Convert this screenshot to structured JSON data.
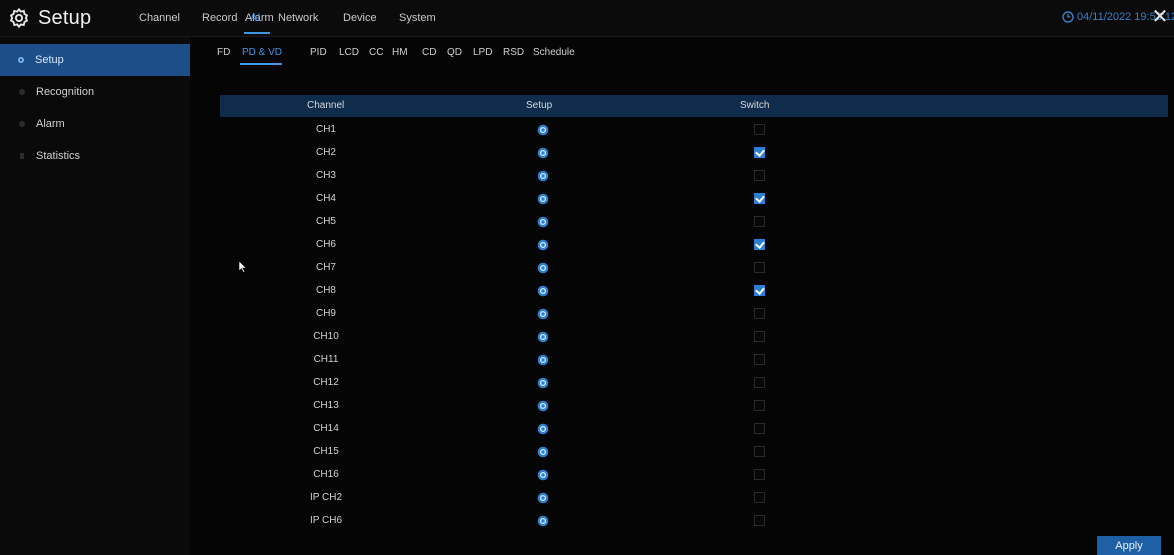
{
  "app": {
    "title": "Setup",
    "datetime": "04/11/2022 19:53:12"
  },
  "main_nav": [
    {
      "label": "Channel"
    },
    {
      "label": "Record"
    },
    {
      "label": "Alarm"
    },
    {
      "label": "AI",
      "active": true
    },
    {
      "label": "Network"
    },
    {
      "label": "Device"
    },
    {
      "label": "System"
    }
  ],
  "sidebar": {
    "items": [
      {
        "label": "Setup",
        "active": true
      },
      {
        "label": "Recognition"
      },
      {
        "label": "Alarm"
      },
      {
        "label": "Statistics"
      }
    ]
  },
  "sub_tabs": [
    {
      "label": "FD"
    },
    {
      "label": "PD & VD",
      "active": true
    },
    {
      "label": "PID"
    },
    {
      "label": "LCD"
    },
    {
      "label": "CC"
    },
    {
      "label": "HM"
    },
    {
      "label": "CD"
    },
    {
      "label": "QD"
    },
    {
      "label": "LPD"
    },
    {
      "label": "RSD"
    },
    {
      "label": "Schedule"
    }
  ],
  "table": {
    "headers": {
      "channel": "Channel",
      "setup": "Setup",
      "switch": "Switch"
    },
    "rows": [
      {
        "channel": "CH1",
        "switch": false
      },
      {
        "channel": "CH2",
        "switch": true
      },
      {
        "channel": "CH3",
        "switch": false
      },
      {
        "channel": "CH4",
        "switch": true
      },
      {
        "channel": "CH5",
        "switch": false
      },
      {
        "channel": "CH6",
        "switch": true
      },
      {
        "channel": "CH7",
        "switch": false
      },
      {
        "channel": "CH8",
        "switch": true
      },
      {
        "channel": "CH9",
        "switch": false
      },
      {
        "channel": "CH10",
        "switch": false
      },
      {
        "channel": "CH11",
        "switch": false
      },
      {
        "channel": "CH12",
        "switch": false
      },
      {
        "channel": "CH13",
        "switch": false
      },
      {
        "channel": "CH14",
        "switch": false
      },
      {
        "channel": "CH15",
        "switch": false
      },
      {
        "channel": "CH16",
        "switch": false
      },
      {
        "channel": "IP CH2",
        "switch": false
      },
      {
        "channel": "IP CH6",
        "switch": false
      }
    ]
  },
  "footer": {
    "apply_label": "Apply"
  },
  "colors": {
    "accent": "#3d95e6",
    "header_bg": "#0f2c4d",
    "active_sidebar": "#1c4f8a"
  }
}
